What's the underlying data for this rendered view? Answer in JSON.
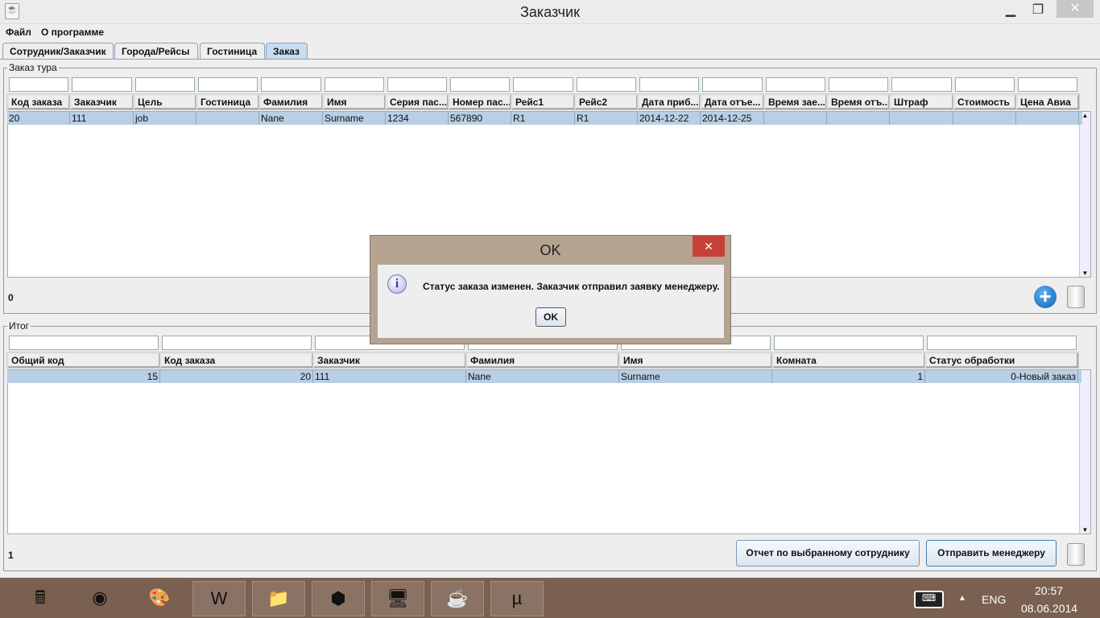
{
  "window": {
    "title": "Заказчик",
    "minimize": "▁",
    "maximize": "❐",
    "close": "✕"
  },
  "menu": [
    "Файл",
    "О программе"
  ],
  "tabs": [
    "Сотрудник/Заказчик",
    "Города/Рейсы",
    "Гостиница",
    "Заказ"
  ],
  "order_group": {
    "label": "Заказ тура",
    "columns": [
      "Код заказа",
      "Заказчик",
      "Цель",
      "Гостиница",
      "Фамилия",
      "Имя",
      "Серия пас...",
      "Номер пас...",
      "Рейс1",
      "Рейс2",
      "Дата приб...",
      "Дата отъе...",
      "Время зае...",
      "Время отъ...",
      "Штраф",
      "Стоимость",
      "Цена Авиа"
    ],
    "rows": [
      [
        "20",
        "111",
        "job",
        "",
        "Nane",
        "Surname",
        "1234",
        "567890",
        "R1",
        "R1",
        "2014-12-22",
        "2014-12-25",
        "",
        "",
        "",
        "",
        ""
      ]
    ],
    "count": "0"
  },
  "total_group": {
    "label": "Итог",
    "columns": [
      "Общий код",
      "Код заказа",
      "Заказчик",
      "Фамилия",
      "Имя",
      "Комната",
      "Статус обработки"
    ],
    "rows": [
      [
        "15",
        "20",
        "111",
        "Nane",
        "Surname",
        "1",
        "0-Новый заказ"
      ]
    ],
    "count": "1",
    "report_button": "Отчет по выбранному сотруднику",
    "send_button": "Отправить менеджеру"
  },
  "dialog": {
    "title": "OK",
    "message": "Статус заказа изменен. Заказчик отправил заявку менеджеру.",
    "ok": "OK",
    "close": "✕",
    "info": "i"
  },
  "taskbar": {
    "apps": [
      "calculator",
      "chrome",
      "paint",
      "word",
      "explorer",
      "virtualbox",
      "remote-desktop",
      "java",
      "utorrent"
    ],
    "lang": "ENG",
    "time": "20:57",
    "date": "08.06.2014",
    "arrow": "▲"
  }
}
